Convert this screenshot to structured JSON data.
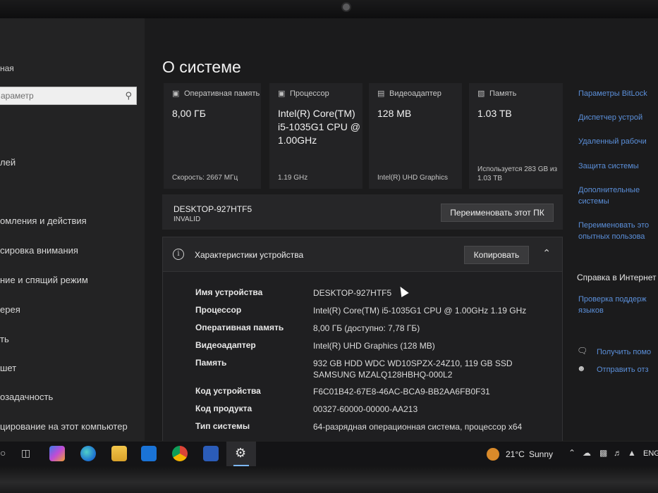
{
  "sidebar": {
    "home_label": "ная",
    "search_placeholder": "араметр",
    "items": [
      {
        "label": "лей"
      },
      {
        "label": "омления и действия"
      },
      {
        "label": "сировка внимания"
      },
      {
        "label": "ние и спящий режим"
      },
      {
        "label": "ерея"
      },
      {
        "label": "ть"
      },
      {
        "label": "шет"
      },
      {
        "label": "озадачность"
      },
      {
        "label": "цирование на этот компьютер"
      }
    ]
  },
  "page_title": "О системе",
  "cards": [
    {
      "icon": "ram-icon",
      "label": "Оперативная память",
      "value": "8,00 ГБ",
      "sub": "Скорость: 2667 МГц"
    },
    {
      "icon": "cpu-icon",
      "label": "Процессор",
      "value": "Intel(R) Core(TM) i5-1035G1 CPU @ 1.00GHz",
      "sub": "1.19 GHz"
    },
    {
      "icon": "gpu-icon",
      "label": "Видеоадаптер",
      "value": "128 MB",
      "sub": "Intel(R) UHD Graphics"
    },
    {
      "icon": "storage-icon",
      "label": "Память",
      "value": "1.03 TB",
      "sub": "Используется 283 GB из 1.03 TB"
    }
  ],
  "device": {
    "name": "DESKTOP-927HTF5",
    "workgroup": "INVALID",
    "rename_label": "Переименовать этот ПК"
  },
  "specs": {
    "title": "Характеристики устройства",
    "copy_label": "Копировать",
    "rows": [
      {
        "key": "Имя устройства",
        "value": "DESKTOP-927HTF5"
      },
      {
        "key": "Процессор",
        "value": "Intel(R) Core(TM) i5-1035G1 CPU @ 1.00GHz   1.19 GHz"
      },
      {
        "key": "Оперативная память",
        "value": "8,00 ГБ (доступно: 7,78 ГБ)"
      },
      {
        "key": "Видеоадаптер",
        "value": "Intel(R) UHD Graphics (128 MB)"
      },
      {
        "key": "Память",
        "value": "932 GB HDD WDC WD10SPZX-24Z10, 119 GB SSD SAMSUNG MZALQ128HBHQ-000L2"
      },
      {
        "key": "Код устройства",
        "value": "F6C01B42-67E8-46AC-BCA9-BB2AA6FB0F31"
      },
      {
        "key": "Код продукта",
        "value": "00327-60000-00000-AA213"
      },
      {
        "key": "Тип системы",
        "value": "64-разрядная операционная система, процессор x64"
      }
    ]
  },
  "related": {
    "links": [
      "Параметры BitLock",
      "Диспетчер устрой",
      "Удаленный рабочи",
      "Защита системы",
      "Дополнительные",
      "системы",
      "Переименовать это",
      "опытных пользова"
    ],
    "help_heading": "Справка в Интернет",
    "help_links": [
      "Проверка поддерж",
      "языков"
    ],
    "get_help": "Получить помо",
    "send_feedback": "Отправить отз"
  },
  "taskbar": {
    "temperature": "21°C",
    "weather": "Sunny",
    "language": "ENG"
  },
  "colors": {
    "accent_link": "#5b8fd9",
    "sun": "#d98a2a"
  }
}
